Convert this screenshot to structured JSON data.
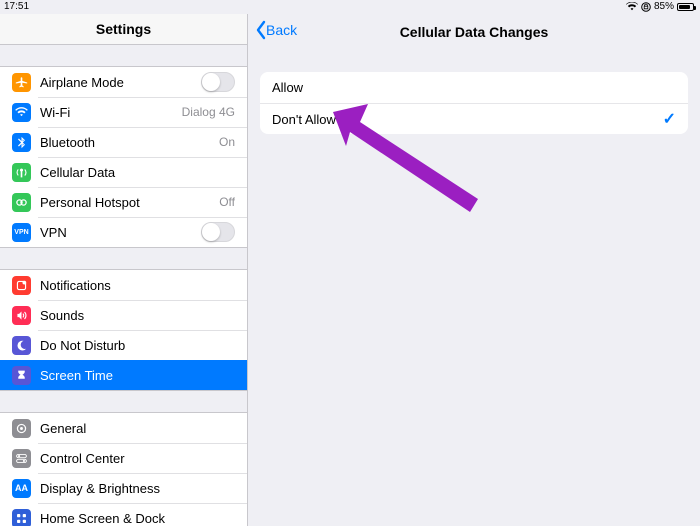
{
  "status": {
    "time": "17:51",
    "battery_pct": "85%",
    "battery_fill_pct": 85
  },
  "sidebar": {
    "title": "Settings",
    "group1": [
      {
        "id": "airplane",
        "label": "Airplane Mode",
        "value": "",
        "icon": "airplane-icon",
        "bg": "#ff9500",
        "control": "toggle"
      },
      {
        "id": "wifi",
        "label": "Wi-Fi",
        "value": "Dialog 4G",
        "icon": "wifi-icon",
        "bg": "#007aff",
        "control": "value"
      },
      {
        "id": "bluetooth",
        "label": "Bluetooth",
        "value": "On",
        "icon": "bluetooth-icon",
        "bg": "#007aff",
        "control": "value"
      },
      {
        "id": "cellular",
        "label": "Cellular Data",
        "value": "",
        "icon": "antenna-icon",
        "bg": "#34c759",
        "control": "none"
      },
      {
        "id": "hotspot",
        "label": "Personal Hotspot",
        "value": "Off",
        "icon": "hotspot-icon",
        "bg": "#34c759",
        "control": "value"
      },
      {
        "id": "vpn",
        "label": "VPN",
        "value": "",
        "icon": "vpn-icon",
        "bg": "#007aff",
        "control": "toggle"
      }
    ],
    "group2": [
      {
        "id": "notifications",
        "label": "Notifications",
        "icon": "bell-icon",
        "bg": "#ff3b30"
      },
      {
        "id": "sounds",
        "label": "Sounds",
        "icon": "speaker-icon",
        "bg": "#ff3b30"
      },
      {
        "id": "dnd",
        "label": "Do Not Disturb",
        "icon": "moon-icon",
        "bg": "#5856d6"
      },
      {
        "id": "screentime",
        "label": "Screen Time",
        "icon": "hourglass-icon",
        "bg": "#5856d6",
        "selected": true
      }
    ],
    "group3": [
      {
        "id": "general",
        "label": "General",
        "icon": "gear-icon",
        "bg": "#8e8e93"
      },
      {
        "id": "controlcenter",
        "label": "Control Center",
        "icon": "switches-icon",
        "bg": "#8e8e93"
      },
      {
        "id": "display",
        "label": "Display & Brightness",
        "icon": "aa-icon",
        "bg": "#007aff"
      },
      {
        "id": "homescreen",
        "label": "Home Screen & Dock",
        "icon": "grid-icon",
        "bg": "#2f5fd8"
      }
    ]
  },
  "detail": {
    "back_label": "Back",
    "title": "Cellular Data Changes",
    "options": [
      {
        "id": "allow",
        "label": "Allow",
        "selected": false
      },
      {
        "id": "dont_allow",
        "label": "Don't Allow",
        "selected": true
      }
    ]
  }
}
